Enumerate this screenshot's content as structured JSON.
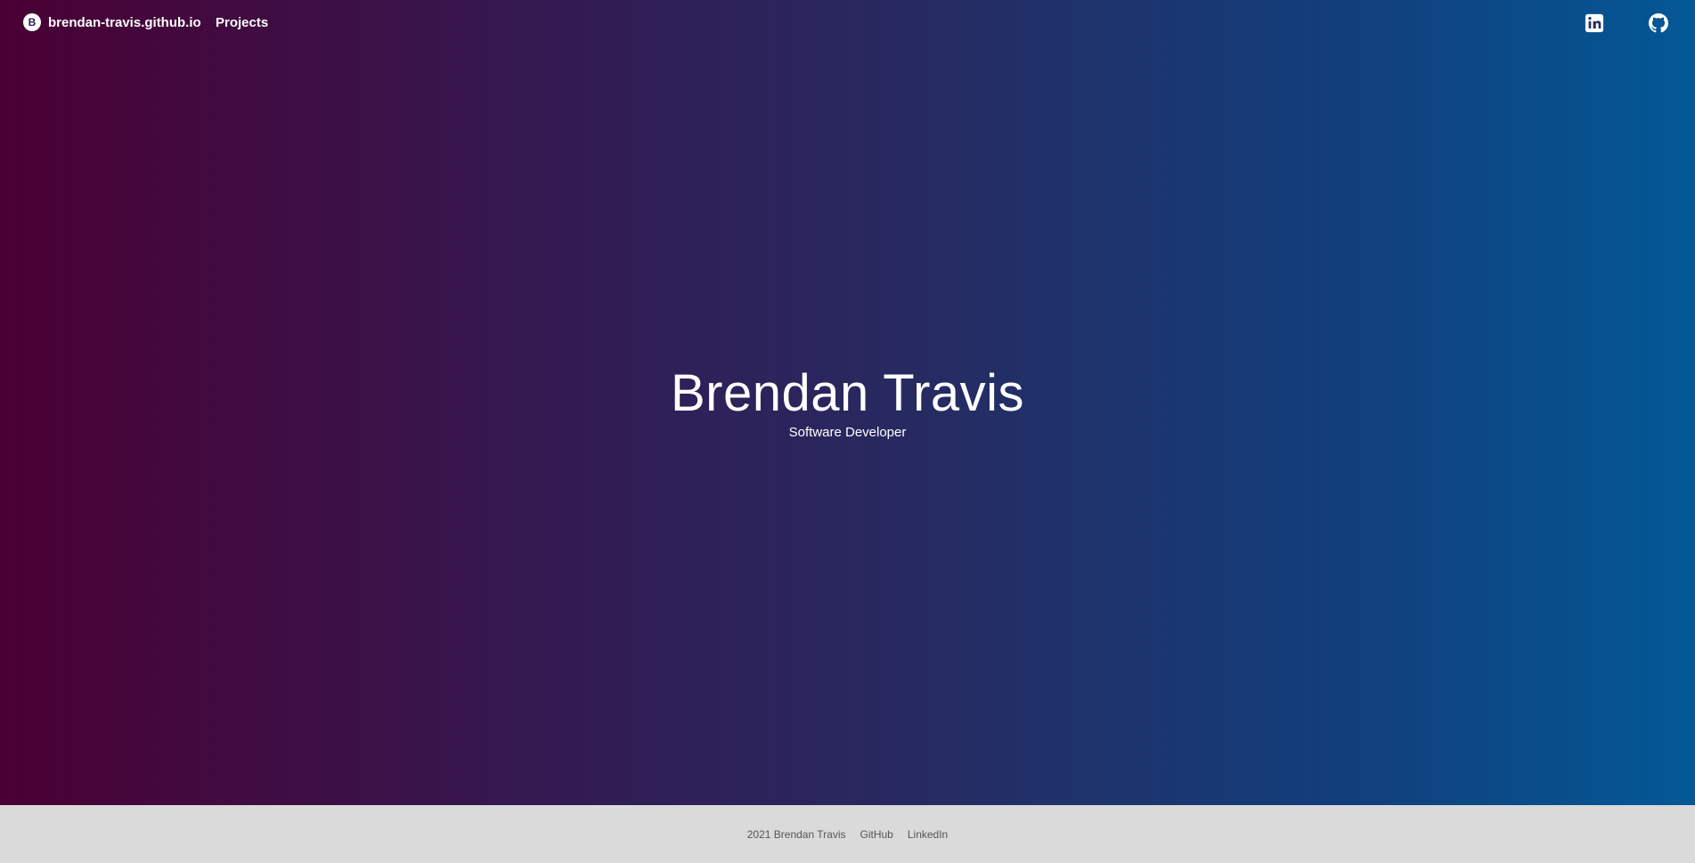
{
  "navbar": {
    "brand_initial": "B",
    "brand_text": "brendan-travis.github.io",
    "links": [
      "Projects"
    ],
    "social": [
      "linkedin-icon",
      "github-icon"
    ]
  },
  "hero": {
    "title": "Brendan Travis",
    "subtitle": "Software Developer"
  },
  "footer": {
    "copyright": "2021 Brendan Travis",
    "github": "GitHub",
    "linkedin": "LinkedIn"
  },
  "colors": {
    "gradient_left": "#4a0034",
    "gradient_right": "#035896",
    "footer_bg": "#dadada"
  }
}
